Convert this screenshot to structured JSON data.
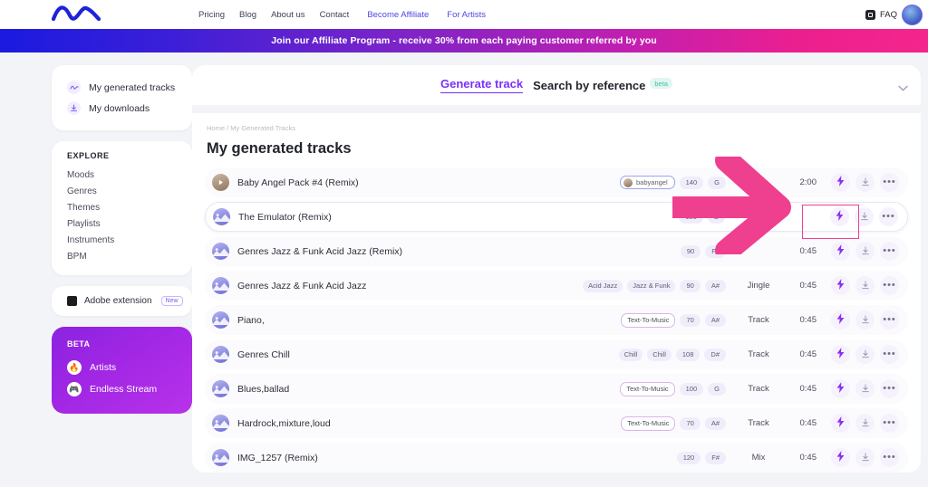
{
  "topnav": {
    "logo_name": "wave-logo",
    "links": [
      {
        "label": "Pricing",
        "accent": false
      },
      {
        "label": "Blog",
        "accent": false
      },
      {
        "label": "About us",
        "accent": false
      },
      {
        "label": "Contact",
        "accent": false
      },
      {
        "label": "Become Affiliate",
        "accent": true
      },
      {
        "label": "For Artists",
        "accent": true
      }
    ],
    "faq_label": "FAQ"
  },
  "banner": {
    "text": "Join our Affiliate Program - receive 30% from each paying customer referred by you",
    "gradient_start": "#1a1ae0",
    "gradient_end": "#f4258c"
  },
  "sidebar": {
    "primary": [
      {
        "label": "My generated tracks",
        "icon": "waveform-icon"
      },
      {
        "label": "My downloads",
        "icon": "download-icon"
      }
    ],
    "explore_title": "EXPLORE",
    "explore": [
      {
        "label": "Moods"
      },
      {
        "label": "Genres"
      },
      {
        "label": "Themes"
      },
      {
        "label": "Playlists"
      },
      {
        "label": "Instruments"
      },
      {
        "label": "BPM"
      }
    ],
    "adobe": {
      "label": "Adobe extension",
      "badge": "New"
    },
    "beta": {
      "title": "BETA",
      "bg_color": "#a227e4",
      "items": [
        {
          "label": "Artists",
          "icon": "fire-icon",
          "glyph": "🔥"
        },
        {
          "label": "Endless Stream",
          "icon": "gamepad-icon",
          "glyph": "🎮"
        }
      ]
    }
  },
  "tabbar": {
    "active_tab": "Generate track",
    "inactive_tab": "Search by reference",
    "beta_pill": "beta",
    "accent_color": "#7b2ff7"
  },
  "main": {
    "breadcrumb": "Home / My Generated Tracks",
    "title": "My generated tracks",
    "tracks": [
      {
        "title": "Baby Angel Pack #4 (Remix)",
        "avatar": "play-avatar",
        "avatar_style": "tan",
        "tags": [
          {
            "label": "babyangel",
            "style": "user"
          },
          {
            "label": "140",
            "style": "num"
          },
          {
            "label": "G",
            "style": "num"
          }
        ],
        "type": "",
        "duration": "2:00",
        "selected": false
      },
      {
        "title": "The Emulator (Remix)",
        "avatar": "wave-avatar",
        "avatar_style": "purple",
        "tags": [
          {
            "label": "180",
            "style": "num"
          },
          {
            "label": "B",
            "style": "num"
          }
        ],
        "type": "",
        "duration": "",
        "selected": true
      },
      {
        "title": "Genres Jazz & Funk Acid Jazz (Remix)",
        "avatar": "wave-avatar",
        "avatar_style": "purple",
        "tags": [
          {
            "label": "90",
            "style": "num"
          },
          {
            "label": "F#",
            "style": "num"
          }
        ],
        "type": "",
        "duration": "0:45",
        "selected": false
      },
      {
        "title": "Genres Jazz & Funk Acid Jazz",
        "avatar": "wave-avatar",
        "avatar_style": "purple",
        "tags": [
          {
            "label": "Acid Jazz",
            "style": "plain"
          },
          {
            "label": "Jazz & Funk",
            "style": "plain"
          },
          {
            "label": "90",
            "style": "num"
          },
          {
            "label": "A#",
            "style": "num"
          }
        ],
        "type": "Jingle",
        "duration": "0:45",
        "selected": false
      },
      {
        "title": "Piano,",
        "avatar": "wave-avatar",
        "avatar_style": "purple",
        "tags": [
          {
            "label": "Text-To-Music",
            "style": "outlined"
          },
          {
            "label": "70",
            "style": "num"
          },
          {
            "label": "A#",
            "style": "num"
          }
        ],
        "type": "Track",
        "duration": "0:45",
        "selected": false
      },
      {
        "title": "Genres Chill",
        "avatar": "wave-avatar",
        "avatar_style": "purple",
        "tags": [
          {
            "label": "Chill",
            "style": "plain"
          },
          {
            "label": "Chill",
            "style": "plain"
          },
          {
            "label": "108",
            "style": "num"
          },
          {
            "label": "D#",
            "style": "num"
          }
        ],
        "type": "Track",
        "duration": "0:45",
        "selected": false
      },
      {
        "title": "Blues,ballad",
        "avatar": "wave-avatar",
        "avatar_style": "purple",
        "tags": [
          {
            "label": "Text-To-Music",
            "style": "outlined"
          },
          {
            "label": "100",
            "style": "num"
          },
          {
            "label": "G",
            "style": "num"
          }
        ],
        "type": "Track",
        "duration": "0:45",
        "selected": false
      },
      {
        "title": "Hardrock,mixture,loud",
        "avatar": "wave-avatar",
        "avatar_style": "purple",
        "tags": [
          {
            "label": "Text-To-Music",
            "style": "outlined"
          },
          {
            "label": "70",
            "style": "num"
          },
          {
            "label": "A#",
            "style": "num"
          }
        ],
        "type": "Track",
        "duration": "0:45",
        "selected": false
      },
      {
        "title": "IMG_1257 (Remix)",
        "avatar": "wave-avatar",
        "avatar_style": "purple",
        "tags": [
          {
            "label": "120",
            "style": "num"
          },
          {
            "label": "F#",
            "style": "num"
          }
        ],
        "type": "Mix",
        "duration": "0:45",
        "selected": false
      }
    ],
    "row_actions": [
      {
        "name": "extend-bolt-button",
        "icon": "bolt-icon"
      },
      {
        "name": "download-button",
        "icon": "download-icon"
      },
      {
        "name": "more-options-button",
        "icon": "ellipsis-icon"
      }
    ]
  },
  "annotation": {
    "arrow_color": "#ef3f8f",
    "highlight_color": "#ef3f8f",
    "arrow_name": "pink-pointer-arrow",
    "highlight_name": "highlight-rectangle"
  }
}
